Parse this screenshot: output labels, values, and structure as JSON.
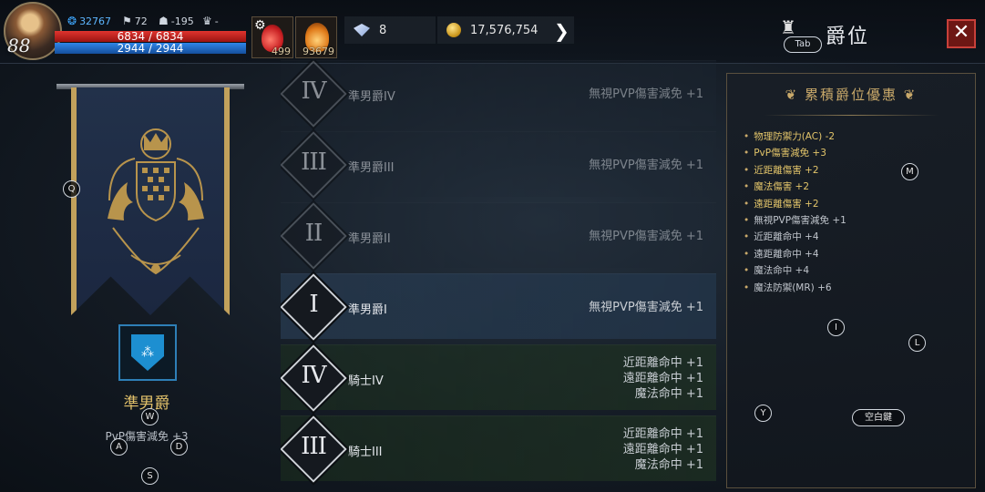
{
  "player": {
    "level": "88",
    "power": "32767",
    "stat_b": "72",
    "stat_c": "-195",
    "stat_d": "-",
    "hp_text": "6834 / 6834",
    "mp_text": "2944 / 2944",
    "hp_fill": 1.0,
    "mp_fill": 1.0
  },
  "quick_slots": [
    {
      "icon": "red-potion-icon",
      "count": "499"
    },
    {
      "icon": "flame-scroll-icon",
      "count": "93679"
    }
  ],
  "currency": {
    "diamonds": "8",
    "gold": "17,576,754"
  },
  "header": {
    "title": "爵位",
    "tab_key": "Tab",
    "close_label": "✕"
  },
  "current_rank": {
    "name": "準男爵",
    "bonus": "PvP傷害減免 +3"
  },
  "ranks": [
    {
      "numeral": "IV",
      "label": "準男爵IV",
      "bonuses": [
        "無視PVP傷害減免 +1"
      ],
      "state": "dim"
    },
    {
      "numeral": "III",
      "label": "準男爵III",
      "bonuses": [
        "無視PVP傷害減免 +1"
      ],
      "state": "dim"
    },
    {
      "numeral": "II",
      "label": "準男爵II",
      "bonuses": [
        "無視PVP傷害減免 +1"
      ],
      "state": "dim"
    },
    {
      "numeral": "I",
      "label": "準男爵I",
      "bonuses": [
        "無視PVP傷害減免 +1"
      ],
      "state": "current"
    },
    {
      "numeral": "IV",
      "label": "騎士IV",
      "bonuses": [
        "近距離命中 +1",
        "遠距離命中 +1",
        "魔法命中 +1"
      ],
      "state": "knight"
    },
    {
      "numeral": "III",
      "label": "騎士III",
      "bonuses": [
        "近距離命中 +1",
        "遠距離命中 +1",
        "魔法命中 +1"
      ],
      "state": "knight"
    }
  ],
  "cumulative": {
    "title": "累積爵位優惠",
    "items": [
      {
        "text": "物理防禦力(AC) -2",
        "highlight": true
      },
      {
        "text": "PvP傷害減免 +3",
        "highlight": true
      },
      {
        "text": "近距離傷害 +2",
        "highlight": true
      },
      {
        "text": "魔法傷害 +2",
        "highlight": true
      },
      {
        "text": "遠距離傷害 +2",
        "highlight": true
      },
      {
        "text": "無視PVP傷害減免 +1",
        "highlight": false
      },
      {
        "text": "近距離命中 +4",
        "highlight": false
      },
      {
        "text": "遠距離命中 +4",
        "highlight": false
      },
      {
        "text": "魔法命中 +4",
        "highlight": false
      },
      {
        "text": "魔法防禦(MR) +6",
        "highlight": false
      }
    ]
  },
  "key_hints": {
    "q": "Q",
    "w": "W",
    "a": "A",
    "s": "S",
    "d": "D",
    "m": "M",
    "i": "I",
    "l": "L",
    "y": "Y",
    "space": "空白鍵"
  },
  "colors": {
    "hp": "#d32a24",
    "mp": "#2a78d6",
    "gold_text": "#e3c56a",
    "close_accent": "#c8403a"
  }
}
